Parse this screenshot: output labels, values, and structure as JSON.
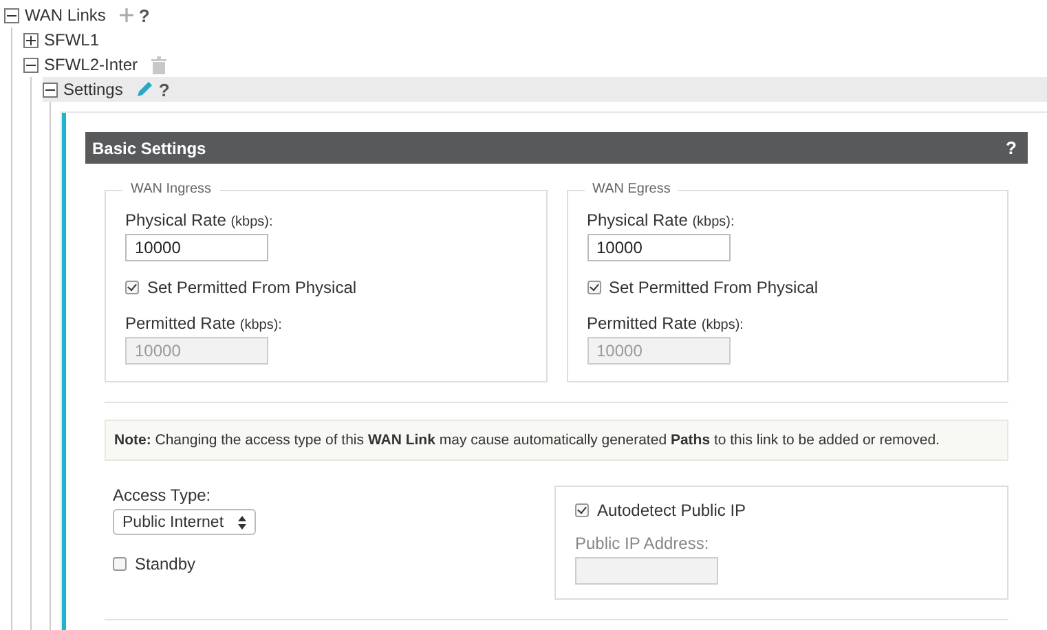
{
  "tree": [
    {
      "label": "WAN Links",
      "expanded": true,
      "add": true,
      "help": "?",
      "children": [
        {
          "label": "SFWL1",
          "expanded": false
        },
        {
          "label": "SFWL2-Inter",
          "expanded": true,
          "delete": true,
          "children": [
            {
              "label": "Settings",
              "expanded": true,
              "selected": true,
              "edit": true,
              "help": "?"
            }
          ]
        }
      ]
    }
  ],
  "panel": {
    "title": "Basic Settings",
    "help": "?",
    "groups": [
      {
        "legend": "WAN Ingress",
        "physical": {
          "label": "Physical Rate",
          "unit": "(kbps):",
          "value": "10000",
          "disabled": false
        },
        "permit": {
          "label": "Set Permitted From Physical",
          "checked": true
        },
        "permitted": {
          "label": "Permitted Rate",
          "unit": "(kbps):",
          "value": "10000",
          "disabled": true
        }
      },
      {
        "legend": "WAN Egress",
        "physical": {
          "label": "Physical Rate",
          "unit": "(kbps):",
          "value": "10000",
          "disabled": false
        },
        "permit": {
          "label": "Set Permitted From Physical",
          "checked": true
        },
        "permitted": {
          "label": "Permitted Rate",
          "unit": "(kbps):",
          "value": "10000",
          "disabled": true
        }
      }
    ],
    "note": "**Note:** Changing the access type of this **WAN Link** may cause automatically generated **Paths** to this link to be added or removed.",
    "access_type": {
      "label": "Access Type:",
      "value": "Public Internet"
    },
    "standby": {
      "label": "Standby",
      "checked": false
    },
    "autodetect": {
      "label": "Autodetect Public IP",
      "checked": true
    },
    "public_ip": {
      "label": "Public IP Address:",
      "disabled": true
    }
  }
}
